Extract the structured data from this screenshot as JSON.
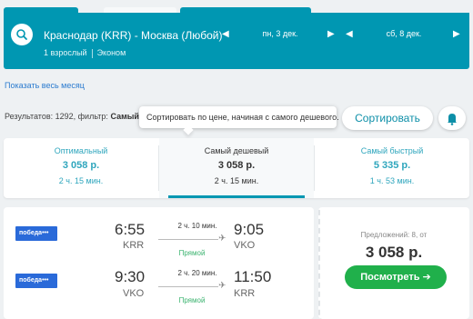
{
  "search": {
    "route": "Краснодар (KRR) - Москва (Любой)",
    "passengers": "1 взрослый",
    "cabin": "Эконом",
    "depart_date": "пн, 3 дек.",
    "return_date": "сб, 8 дек."
  },
  "month_link": "Показать весь месяц",
  "results": {
    "text": "Результатов: 1292, фильтр:",
    "filter": "Самый де"
  },
  "tooltip": "Сортировать по цене, начиная с самого дешевого.",
  "sort_button": "Сортировать",
  "sort_tabs": [
    {
      "title": "Оптимальный",
      "price": "3 058 р.",
      "duration": "2 ч. 15 мин."
    },
    {
      "title": "Самый дешевый",
      "price": "3 058 р.",
      "duration": "2 ч. 15 мин."
    },
    {
      "title": "Самый быстрый",
      "price": "5 335 р.",
      "duration": "1 ч. 53 мин."
    }
  ],
  "ticket": {
    "segments": [
      {
        "airline": "победа",
        "dep_time": "6:55",
        "dep_code": "KRR",
        "arr_time": "9:05",
        "arr_code": "VKO",
        "duration": "2 ч. 10 мин.",
        "type": "Прямой"
      },
      {
        "airline": "победа",
        "dep_time": "9:30",
        "dep_code": "VKO",
        "arr_time": "11:50",
        "arr_code": "KRR",
        "duration": "2 ч. 20 мин.",
        "type": "Прямой"
      }
    ],
    "offers": "Предложений: 8, от",
    "price": "3 058 р.",
    "view_button": "Посмотреть ➔"
  },
  "colors": {
    "brand": "#0097b2",
    "accent_link": "#2fa6bd",
    "cta": "#20b04b",
    "airline_logo": "#2a6ad9"
  }
}
